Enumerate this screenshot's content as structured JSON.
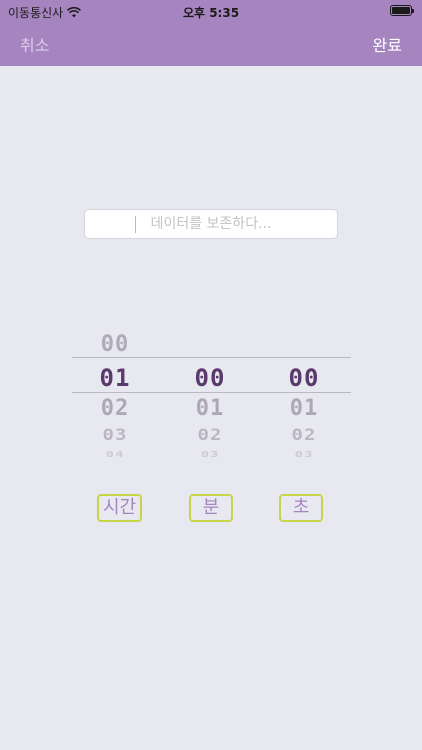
{
  "status_bar": {
    "carrier": "이동통신사",
    "time": "오후 5:35",
    "wifi_icon": "wifi-icon",
    "battery_icon": "battery-icon"
  },
  "nav": {
    "cancel_label": "취소",
    "done_label": "완료",
    "bar_color": "#a684c0"
  },
  "text_field": {
    "value": "",
    "placeholder": "데이터를 보존하다..."
  },
  "picker": {
    "hours": {
      "above": "00",
      "selected": "01",
      "below": [
        "02",
        "03",
        "04"
      ]
    },
    "minutes": {
      "selected": "00",
      "below": [
        "01",
        "02",
        "03"
      ]
    },
    "seconds": {
      "selected": "00",
      "below": [
        "01",
        "02",
        "03"
      ]
    },
    "selected_color": "#5a3a6c"
  },
  "units": {
    "hours_label": "시간",
    "minutes_label": "분",
    "seconds_label": "초",
    "border_color": "#c8d44a"
  }
}
